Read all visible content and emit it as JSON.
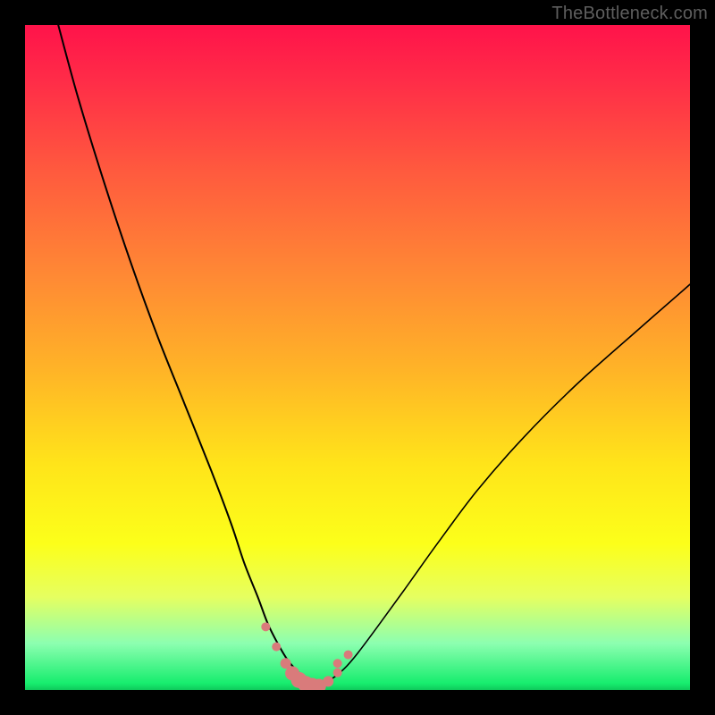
{
  "watermark": {
    "text": "TheBottleneck.com"
  },
  "colors": {
    "curve_stroke": "#000000",
    "marker_fill": "#d97b7b",
    "marker_stroke": "#c06767"
  },
  "chart_data": {
    "type": "line",
    "title": "",
    "xlabel": "",
    "ylabel": "",
    "xlim": [
      0,
      100
    ],
    "ylim": [
      0,
      100
    ],
    "grid": false,
    "legend": false,
    "series": [
      {
        "name": "left-curve",
        "x": [
          5,
          8,
          12,
          16,
          20,
          24,
          28,
          31,
          33,
          35,
          36.5,
          38,
          39.5,
          41,
          42.5,
          44
        ],
        "y": [
          100,
          89,
          76,
          64,
          53,
          43,
          33,
          25,
          19,
          14,
          10,
          7,
          4.5,
          2.8,
          1.5,
          0.8
        ]
      },
      {
        "name": "right-curve",
        "x": [
          44,
          46,
          48,
          50,
          53,
          57,
          62,
          68,
          75,
          83,
          92,
          100
        ],
        "y": [
          0.8,
          1.6,
          3.2,
          5.5,
          9.5,
          15,
          22,
          30,
          38,
          46,
          54,
          61
        ]
      }
    ],
    "markers": {
      "name": "bottom-markers",
      "x": [
        36.2,
        37.8,
        39.2,
        40.2,
        41.2,
        42.2,
        43.2,
        44.2,
        45.6,
        47.0,
        47.0,
        48.6
      ],
      "y": [
        9.5,
        6.5,
        4.0,
        2.5,
        1.5,
        0.9,
        0.6,
        0.6,
        1.3,
        2.6,
        4.0,
        5.3
      ],
      "r": [
        5,
        5,
        6,
        8,
        9,
        9,
        9,
        8,
        6,
        5,
        5,
        5
      ]
    }
  }
}
